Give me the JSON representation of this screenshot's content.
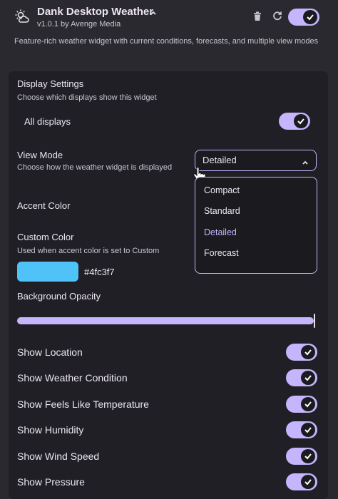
{
  "header": {
    "title": "Dank Desktop Weather",
    "version": "v1.0.1 by Avenge Media",
    "description": "Feature-rich weather widget with current conditions, forecasts, and multiple view modes",
    "icons": [
      "weather-sun-cloud-icon",
      "chevron-up-icon",
      "trash-icon",
      "refresh-icon"
    ],
    "enabled": true
  },
  "display_settings": {
    "heading": "Display Settings",
    "subheading": "Choose which displays show this widget",
    "all_displays_label": "All displays",
    "all_displays_enabled": true
  },
  "view_mode": {
    "label": "View Mode",
    "sub": "Choose how the weather widget is displayed",
    "selected": "Detailed",
    "options": [
      "Compact",
      "Standard",
      "Detailed",
      "Forecast"
    ]
  },
  "accent_color": {
    "label": "Accent Color"
  },
  "custom_color": {
    "label": "Custom Color",
    "sub": "Used when accent color is set to Custom",
    "hex": "#4fc3f7"
  },
  "background_opacity": {
    "label": "Background Opacity",
    "value": 1.0
  },
  "toggles": [
    {
      "label": "Show Location",
      "enabled": true
    },
    {
      "label": "Show Weather Condition",
      "enabled": true
    },
    {
      "label": "Show Feels Like Temperature",
      "enabled": true
    },
    {
      "label": "Show Humidity",
      "enabled": true
    },
    {
      "label": "Show Wind Speed",
      "enabled": true
    },
    {
      "label": "Show Pressure",
      "enabled": true
    }
  ],
  "colors": {
    "accent": "#c4b5fd",
    "background": "#2b2930",
    "panel": "#211f26",
    "swatch": "#4fc3f7"
  }
}
